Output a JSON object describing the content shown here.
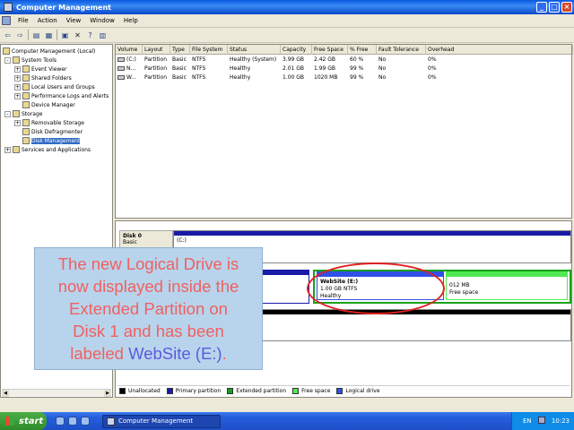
{
  "window": {
    "title": "Computer Management"
  },
  "menu": [
    "File",
    "Action",
    "View",
    "Window",
    "Help"
  ],
  "toolbar_icons": [
    "back-arrow-icon",
    "forward-arrow-icon",
    "up-folder-icon",
    "show-tree-icon",
    "properties-icon",
    "delete-icon",
    "help-icon",
    "export-icon"
  ],
  "tree": [
    {
      "label": "Computer Management (Local)",
      "level": 0,
      "toggle": ""
    },
    {
      "label": "System Tools",
      "level": 1,
      "toggle": "-"
    },
    {
      "label": "Event Viewer",
      "level": 2,
      "toggle": "+"
    },
    {
      "label": "Shared Folders",
      "level": 2,
      "toggle": "+"
    },
    {
      "label": "Local Users and Groups",
      "level": 2,
      "toggle": "+"
    },
    {
      "label": "Performance Logs and Alerts",
      "level": 2,
      "toggle": "+"
    },
    {
      "label": "Device Manager",
      "level": 2,
      "toggle": ""
    },
    {
      "label": "Storage",
      "level": 1,
      "toggle": "-"
    },
    {
      "label": "Removable Storage",
      "level": 2,
      "toggle": "+"
    },
    {
      "label": "Disk Defragmenter",
      "level": 2,
      "toggle": ""
    },
    {
      "label": "Disk Management",
      "level": 2,
      "toggle": "",
      "selected": true
    },
    {
      "label": "Services and Applications",
      "level": 1,
      "toggle": "+"
    }
  ],
  "volumes": {
    "columns": [
      "Volume",
      "Layout",
      "Type",
      "File System",
      "Status",
      "Capacity",
      "Free Space",
      "% Free",
      "Fault Tolerance",
      "Overhead"
    ],
    "rows": [
      [
        "(C:)",
        "Partition",
        "Basic",
        "NTFS",
        "Healthy (System)",
        "3.99 GB",
        "2.42 GB",
        "60 %",
        "No",
        "0%"
      ],
      [
        "N...",
        "Partition",
        "Basic",
        "NTFS",
        "Healthy",
        "2.01 GB",
        "1.99 GB",
        "99 %",
        "No",
        "0%"
      ],
      [
        "W...",
        "Partition",
        "Basic",
        "NTFS",
        "Healthy",
        "1.00 GB",
        "1020 MB",
        "99 %",
        "No",
        "0%"
      ]
    ]
  },
  "disks": {
    "disk0": {
      "name": "Disk 0",
      "type": "Basic",
      "partition": "(C:)"
    },
    "disk1": {
      "website_name": "WebSite (E:)",
      "website_size": "1.00 GB NTFS",
      "website_status": "Healthy",
      "free_size": "012 MB",
      "free_label": "Free space"
    }
  },
  "legend": [
    "Unallocated",
    "Primary partition",
    "Extended partition",
    "Free space",
    "Logical drive"
  ],
  "legend_colors": [
    "#000000",
    "#1a1aa8",
    "#18a018",
    "#50e850",
    "#3050e8"
  ],
  "callout": {
    "line1": "The new Logical Drive is",
    "line2": "now displayed inside the",
    "line3": "Extended Partition on",
    "line4": "Disk 1 and has been",
    "line5a": "labeled ",
    "line5b": "WebSite (E:)",
    "line5c": "."
  },
  "taskbar": {
    "start_label": "start",
    "task_label": "Computer Management",
    "lang": "EN",
    "clock": "10:23"
  }
}
